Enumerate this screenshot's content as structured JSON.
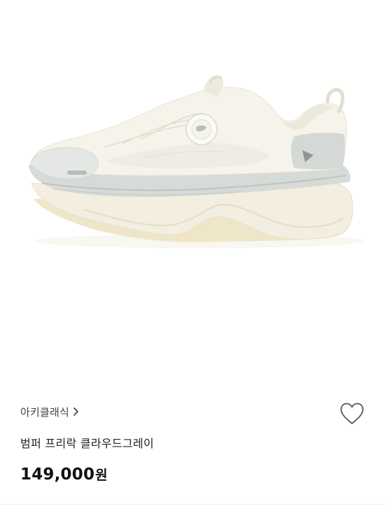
{
  "product": {
    "brand": "아키클래식",
    "name": "범퍼 프리락 클라우드그레이",
    "price_value": "149,000",
    "price_unit": "원"
  },
  "icons": {
    "brand_chevron": "chevron-right-icon",
    "wishlist": "heart-outline-icon"
  },
  "colors": {
    "text_primary": "#111111",
    "text_secondary": "#444444",
    "heart_stroke": "#555555",
    "shoe_upper": "#f3f1e6",
    "shoe_sole": "#f1ecde",
    "shoe_accent_gray": "#cfd3d0"
  }
}
